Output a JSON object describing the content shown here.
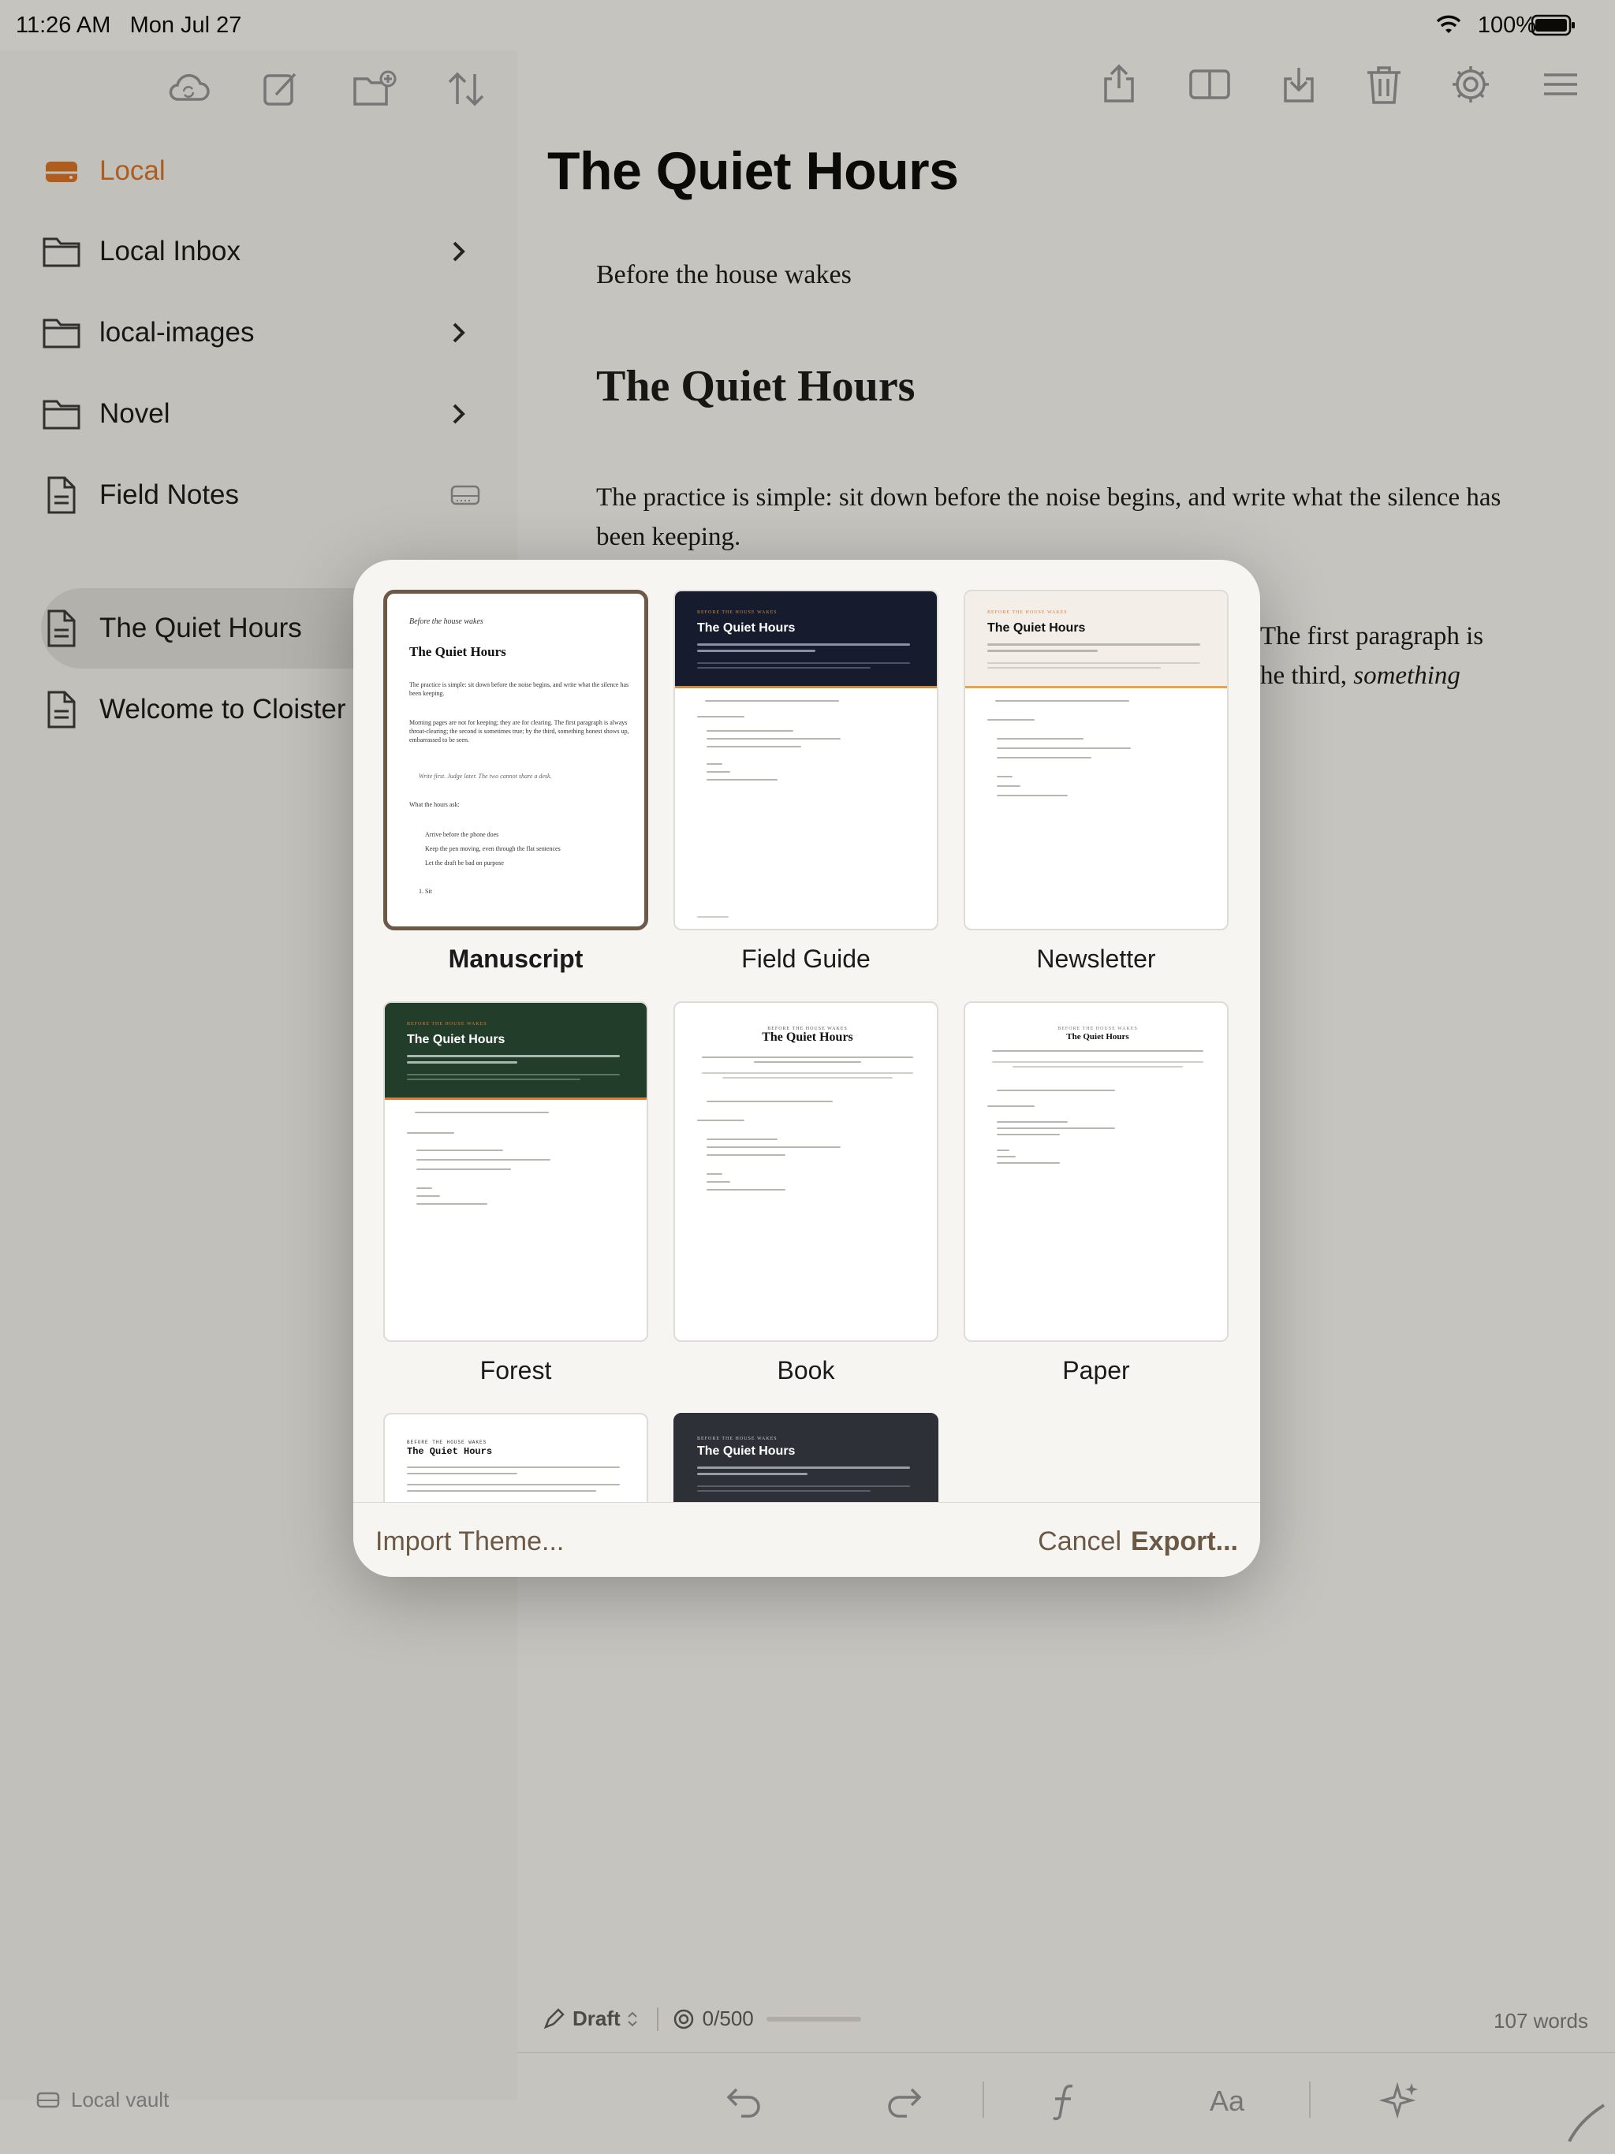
{
  "status": {
    "time": "11:26 AM",
    "date": "Mon Jul 27",
    "battery": "100%"
  },
  "sidebar": {
    "vault_root": "Local",
    "items": [
      {
        "label": "Local Inbox",
        "type": "folder"
      },
      {
        "label": "local-images",
        "type": "folder"
      },
      {
        "label": "Novel",
        "type": "folder"
      },
      {
        "label": "Field Notes",
        "type": "file"
      },
      {
        "label": "The Quiet Hours",
        "type": "file",
        "selected": true
      },
      {
        "label": "Welcome to Cloister",
        "type": "file"
      }
    ],
    "footer": "Local vault"
  },
  "document": {
    "title": "The Quiet Hours",
    "subtitle": "Before the house wakes",
    "heading": "The Quiet Hours",
    "para1": "The practice is simple: sit down before the noise begins, and write what the silence has been keeping.",
    "para2_line1": "The first paragraph is",
    "para2_line2_a": "he third, ",
    "para2_line2_b": "something"
  },
  "preview": {
    "kicker": "BEFORE THE HOUSE WAKES",
    "subtitle": "Before the house wakes",
    "title": "The Quiet Hours",
    "p1": "The practice is simple: sit down before the noise begins, and write what the silence has been keeping.",
    "p2": "Morning pages are not for keeping; they are for clearing. The first paragraph is always throat-clearing; the second is sometimes true; by the third, something honest shows up, embarrassed to be seen.",
    "quote": "Write first. Judge later. The two cannot share a desk.",
    "list_title": "What the hours ask:",
    "bullets": [
      "Arrive before the phone does",
      "Keep the pen moving, even through the flat sentences",
      "Let the draft be bad on purpose"
    ],
    "numbered": [
      "1. Sit"
    ]
  },
  "themes": [
    {
      "name": "Manuscript",
      "selected": true
    },
    {
      "name": "Field Guide"
    },
    {
      "name": "Newsletter"
    },
    {
      "name": "Forest"
    },
    {
      "name": "Book"
    },
    {
      "name": "Paper"
    }
  ],
  "modal": {
    "import": "Import Theme...",
    "cancel": "Cancel",
    "export": "Export..."
  },
  "editor_status": {
    "mode": "Draft",
    "goal": "0/500",
    "words": "107 words"
  },
  "colors": {
    "accent": "#6b5845",
    "vault_orange": "#d96d1f",
    "field_guide": "#161b2e",
    "forest": "#233d2b",
    "dark_theme": "#2d3037"
  }
}
